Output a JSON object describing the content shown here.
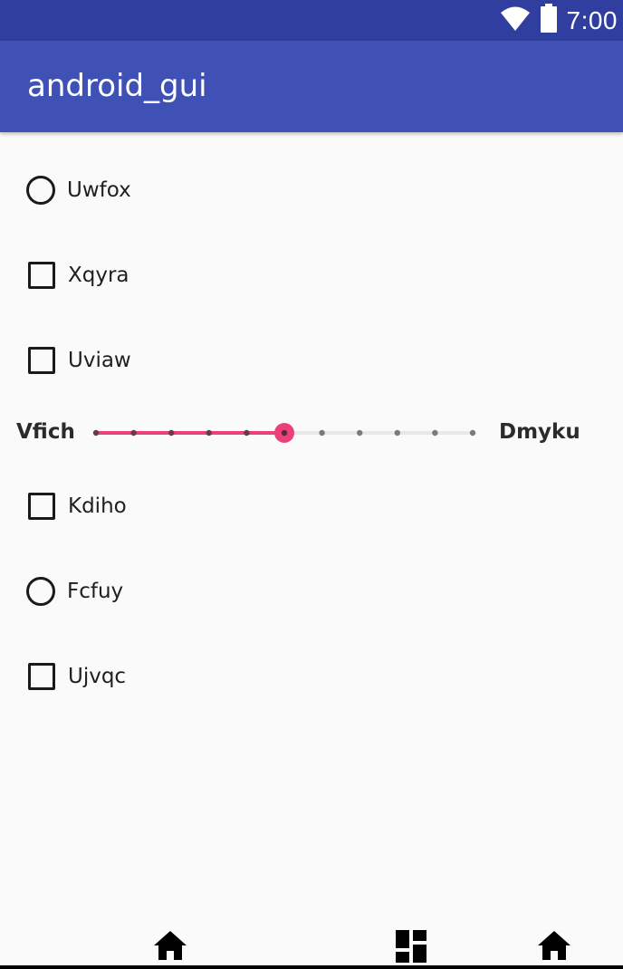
{
  "status_bar": {
    "time": "7:00",
    "icons": [
      "wifi-icon",
      "battery-icon"
    ]
  },
  "app_bar": {
    "title": "android_gui"
  },
  "items": [
    {
      "type": "radio",
      "label": "Uwfox",
      "checked": false
    },
    {
      "type": "checkbox",
      "label": "Xqyra",
      "checked": false
    },
    {
      "type": "checkbox",
      "label": "Uviaw",
      "checked": false
    },
    {
      "type": "checkbox",
      "label": "Kdiho",
      "checked": false
    },
    {
      "type": "radio",
      "label": "Fcfuy",
      "checked": false
    },
    {
      "type": "checkbox",
      "label": "Ujvqc",
      "checked": false
    }
  ],
  "slider": {
    "min_label": "Vfich",
    "max_label": "Dmyku",
    "steps": 10,
    "value": 5,
    "accent_color": "#ec407a"
  },
  "nav_bar": {
    "buttons": [
      "home-icon",
      "dashboard-icon",
      "home-icon"
    ]
  },
  "colors": {
    "status_bar": "#303f9f",
    "app_bar": "#3f51b5",
    "background": "#fafafa"
  }
}
